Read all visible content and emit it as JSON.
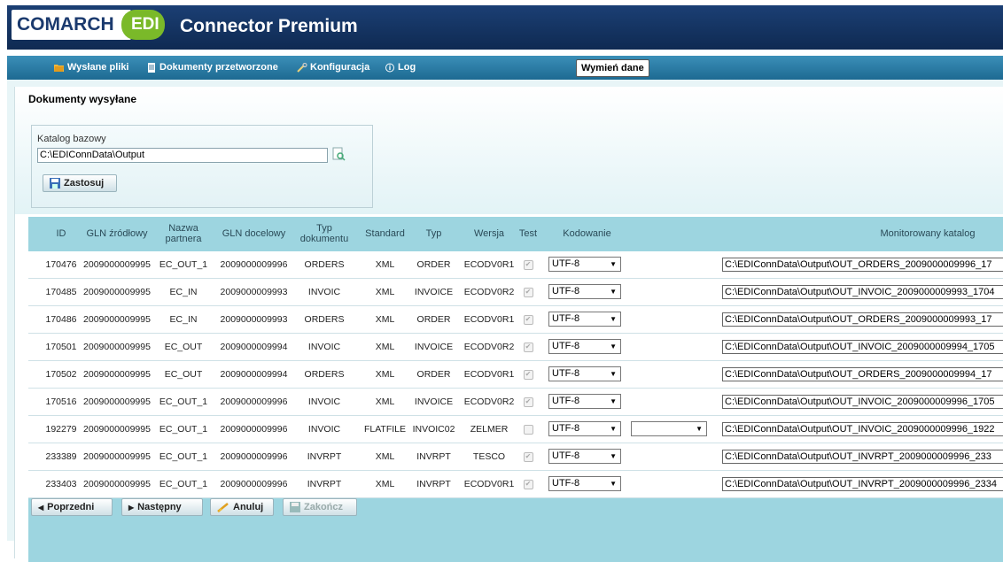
{
  "app": {
    "logo_text": "COMARCH",
    "logo_edi": "EDI",
    "title": "Connector Premium"
  },
  "nav": {
    "items": [
      {
        "label": "Wysłane pliki",
        "icon": "folder-icon"
      },
      {
        "label": "Dokumenty przetworzone",
        "icon": "document-icon"
      },
      {
        "label": "Konfiguracja",
        "icon": "tools-icon"
      },
      {
        "label": "Log",
        "icon": "info-icon"
      }
    ],
    "exchange_button": "Wymień dane"
  },
  "page": {
    "title": "Dokumenty wysyłane",
    "katalog_label": "Katalog bazowy",
    "katalog_value": "C:\\EDIConnData\\Output",
    "apply_button": "Zastosuj"
  },
  "table": {
    "headers": [
      "ID",
      "GLN źródłowy",
      "Nazwa partnera",
      "GLN docelowy",
      "Typ dokumentu",
      "Standard",
      "Typ",
      "Wersja",
      "Test",
      "Kodowanie",
      "Monitorowany katalog"
    ],
    "rows": [
      {
        "id": "170476",
        "gln_src": "2009000009995",
        "partner": "EC_OUT_1",
        "gln_dst": "2009000009996",
        "doc_type": "ORDERS",
        "standard": "XML",
        "typ": "ORDER",
        "wersja": "ECODV0R1",
        "test": true,
        "kodowanie": "UTF-8",
        "katalog": "C:\\EDIConnData\\Output\\OUT_ORDERS_2009000009996_17"
      },
      {
        "id": "170485",
        "gln_src": "2009000009995",
        "partner": "EC_IN",
        "gln_dst": "2009000009993",
        "doc_type": "INVOIC",
        "standard": "XML",
        "typ": "INVOICE",
        "wersja": "ECODV0R2",
        "test": true,
        "kodowanie": "UTF-8",
        "katalog": "C:\\EDIConnData\\Output\\OUT_INVOIC_2009000009993_1704"
      },
      {
        "id": "170486",
        "gln_src": "2009000009995",
        "partner": "EC_IN",
        "gln_dst": "2009000009993",
        "doc_type": "ORDERS",
        "standard": "XML",
        "typ": "ORDER",
        "wersja": "ECODV0R1",
        "test": true,
        "kodowanie": "UTF-8",
        "katalog": "C:\\EDIConnData\\Output\\OUT_ORDERS_2009000009993_17"
      },
      {
        "id": "170501",
        "gln_src": "2009000009995",
        "partner": "EC_OUT",
        "gln_dst": "2009000009994",
        "doc_type": "INVOIC",
        "standard": "XML",
        "typ": "INVOICE",
        "wersja": "ECODV0R2",
        "test": true,
        "kodowanie": "UTF-8",
        "katalog": "C:\\EDIConnData\\Output\\OUT_INVOIC_2009000009994_1705"
      },
      {
        "id": "170502",
        "gln_src": "2009000009995",
        "partner": "EC_OUT",
        "gln_dst": "2009000009994",
        "doc_type": "ORDERS",
        "standard": "XML",
        "typ": "ORDER",
        "wersja": "ECODV0R1",
        "test": true,
        "kodowanie": "UTF-8",
        "katalog": "C:\\EDIConnData\\Output\\OUT_ORDERS_2009000009994_17"
      },
      {
        "id": "170516",
        "gln_src": "2009000009995",
        "partner": "EC_OUT_1",
        "gln_dst": "2009000009996",
        "doc_type": "INVOIC",
        "standard": "XML",
        "typ": "INVOICE",
        "wersja": "ECODV0R2",
        "test": true,
        "kodowanie": "UTF-8",
        "katalog": "C:\\EDIConnData\\Output\\OUT_INVOIC_2009000009996_1705"
      },
      {
        "id": "192279",
        "gln_src": "2009000009995",
        "partner": "EC_OUT_1",
        "gln_dst": "2009000009996",
        "doc_type": "INVOIC",
        "standard": "FLATFILE",
        "typ": "INVOIC02",
        "wersja": "ZELMER",
        "test": false,
        "kodowanie": "UTF-8",
        "extra_select": "",
        "katalog": "C:\\EDIConnData\\Output\\OUT_INVOIC_2009000009996_1922"
      },
      {
        "id": "233389",
        "gln_src": "2009000009995",
        "partner": "EC_OUT_1",
        "gln_dst": "2009000009996",
        "doc_type": "INVRPT",
        "standard": "XML",
        "typ": "INVRPT",
        "wersja": "TESCO",
        "test": true,
        "kodowanie": "UTF-8",
        "katalog": "C:\\EDIConnData\\Output\\OUT_INVRPT_2009000009996_233"
      },
      {
        "id": "233403",
        "gln_src": "2009000009995",
        "partner": "EC_OUT_1",
        "gln_dst": "2009000009996",
        "doc_type": "INVRPT",
        "standard": "XML",
        "typ": "INVRPT",
        "wersja": "ECODV0R1",
        "test": true,
        "kodowanie": "UTF-8",
        "katalog": "C:\\EDIConnData\\Output\\OUT_INVRPT_2009000009996_2334"
      }
    ]
  },
  "footer": {
    "prev": "Poprzedni",
    "next": "Następny",
    "cancel": "Anuluj",
    "finish": "Zakończ"
  },
  "colors": {
    "header_bg": "#1b3f74",
    "nav_bg": "#2a7ea6",
    "grid_bg": "#9dd5e0",
    "edi_green": "#7ab929"
  }
}
